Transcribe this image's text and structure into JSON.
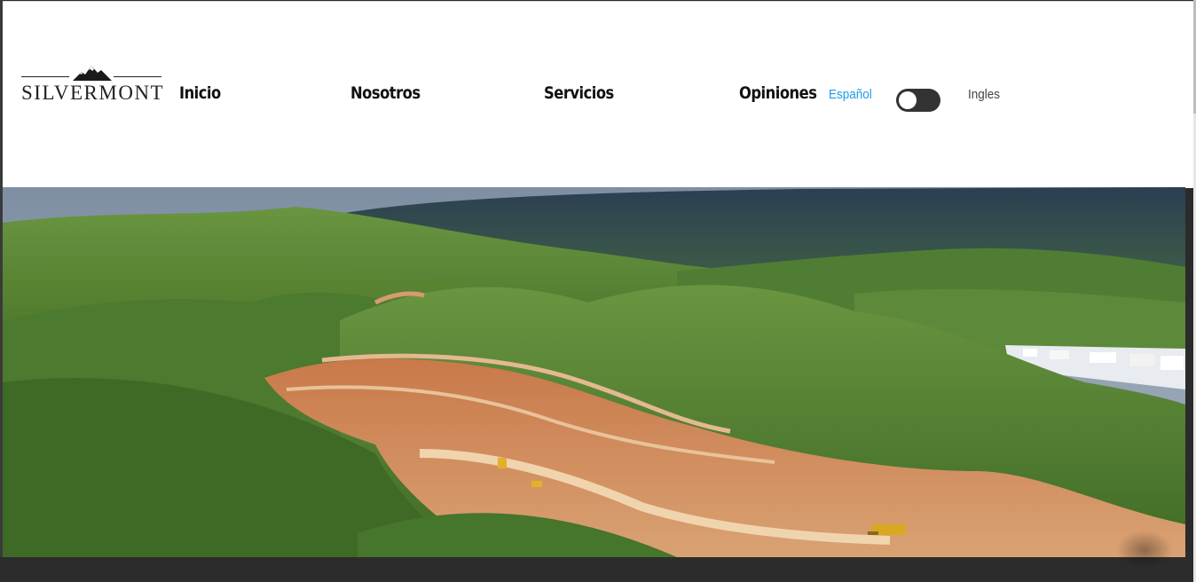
{
  "brand": {
    "logo_text": "SILVERMONT",
    "logo_icon": "mountain-icon"
  },
  "nav": {
    "items": [
      {
        "label": "Inicio"
      },
      {
        "label": "Nosotros"
      },
      {
        "label": "Servicios"
      },
      {
        "label": "Opiniones"
      }
    ]
  },
  "language": {
    "spanish": "Español",
    "english": "Ingles",
    "toggle_state": "off"
  },
  "colors": {
    "accent": "#1e9be9",
    "toggle_bg": "#333333",
    "page_bg": "#2b2b2b"
  },
  "hero": {
    "image": "aerial-hills-construction-site"
  }
}
